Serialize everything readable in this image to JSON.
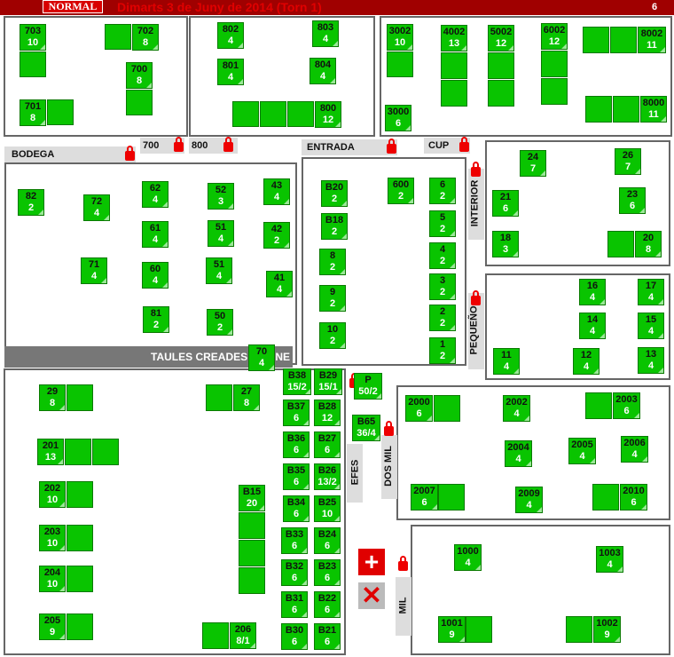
{
  "header": {
    "mode_badge": "NORMAL",
    "title": "Dimarts 3 de Juny de 2014 (Torn 1)",
    "page_number": "6"
  },
  "zone_labels": {
    "bodega": "BODEGA",
    "entrada": "ENTRADA",
    "cup": "CUP",
    "interior": "INTERIOR",
    "pequeno": "PEQUEÑO",
    "taules_creades": "TAULES CREADES",
    "online": "INE",
    "efes": "EFES",
    "dosmil": "DOS MIL",
    "mil": "MIL",
    "gate_700": "700",
    "gate_800": "800"
  },
  "tables": [
    {
      "name": "703",
      "covers": "10"
    },
    {
      "name": "702",
      "covers": "8"
    },
    {
      "name": "700",
      "covers": "8"
    },
    {
      "name": "701",
      "covers": "8"
    },
    {
      "name": "802",
      "covers": "4"
    },
    {
      "name": "803",
      "covers": "4"
    },
    {
      "name": "801",
      "covers": "4"
    },
    {
      "name": "804",
      "covers": "4"
    },
    {
      "name": "800",
      "covers": "12"
    },
    {
      "name": "3002",
      "covers": "10"
    },
    {
      "name": "4002",
      "covers": "13"
    },
    {
      "name": "5002",
      "covers": "12"
    },
    {
      "name": "6002",
      "covers": "12"
    },
    {
      "name": "8002",
      "covers": "11"
    },
    {
      "name": "3000",
      "covers": "6"
    },
    {
      "name": "8000",
      "covers": "11"
    },
    {
      "name": "82",
      "covers": "2"
    },
    {
      "name": "72",
      "covers": "4"
    },
    {
      "name": "62",
      "covers": "4"
    },
    {
      "name": "52",
      "covers": "3"
    },
    {
      "name": "43",
      "covers": "4"
    },
    {
      "name": "61",
      "covers": "4"
    },
    {
      "name": "51",
      "covers": "4"
    },
    {
      "name": "42",
      "covers": "2"
    },
    {
      "name": "71",
      "covers": "4"
    },
    {
      "name": "60",
      "covers": "4"
    },
    {
      "name": "51",
      "covers": "4"
    },
    {
      "name": "41",
      "covers": "4"
    },
    {
      "name": "81",
      "covers": "2"
    },
    {
      "name": "50",
      "covers": "2"
    },
    {
      "name": "70",
      "covers": "4"
    },
    {
      "name": "B20",
      "covers": "2"
    },
    {
      "name": "600",
      "covers": "2"
    },
    {
      "name": "6",
      "covers": "2"
    },
    {
      "name": "B18",
      "covers": "2"
    },
    {
      "name": "5",
      "covers": "2"
    },
    {
      "name": "8",
      "covers": "2"
    },
    {
      "name": "4",
      "covers": "2"
    },
    {
      "name": "9",
      "covers": "2"
    },
    {
      "name": "3",
      "covers": "2"
    },
    {
      "name": "10",
      "covers": "2"
    },
    {
      "name": "2",
      "covers": "2"
    },
    {
      "name": "1",
      "covers": "2"
    },
    {
      "name": "24",
      "covers": "7"
    },
    {
      "name": "26",
      "covers": "7"
    },
    {
      "name": "21",
      "covers": "6"
    },
    {
      "name": "23",
      "covers": "6"
    },
    {
      "name": "18",
      "covers": "3"
    },
    {
      "name": "20",
      "covers": "8"
    },
    {
      "name": "16",
      "covers": "4"
    },
    {
      "name": "17",
      "covers": "4"
    },
    {
      "name": "14",
      "covers": "4"
    },
    {
      "name": "15",
      "covers": "4"
    },
    {
      "name": "11",
      "covers": "4"
    },
    {
      "name": "12",
      "covers": "4"
    },
    {
      "name": "13",
      "covers": "4"
    },
    {
      "name": "29",
      "covers": "8"
    },
    {
      "name": "27",
      "covers": "8"
    },
    {
      "name": "201",
      "covers": "13"
    },
    {
      "name": "202",
      "covers": "10"
    },
    {
      "name": "203",
      "covers": "10"
    },
    {
      "name": "204",
      "covers": "10"
    },
    {
      "name": "205",
      "covers": "9"
    },
    {
      "name": "206",
      "covers": "8/1"
    },
    {
      "name": "B15",
      "covers": "20"
    },
    {
      "name": "B38",
      "covers": "15/2"
    },
    {
      "name": "B29",
      "covers": "15/1"
    },
    {
      "name": "B37",
      "covers": "6"
    },
    {
      "name": "B28",
      "covers": "12"
    },
    {
      "name": "B36",
      "covers": "6"
    },
    {
      "name": "B27",
      "covers": "6"
    },
    {
      "name": "B35",
      "covers": "6"
    },
    {
      "name": "B26",
      "covers": "13/2"
    },
    {
      "name": "B34",
      "covers": "6"
    },
    {
      "name": "B25",
      "covers": "10"
    },
    {
      "name": "B33",
      "covers": "6"
    },
    {
      "name": "B24",
      "covers": "6"
    },
    {
      "name": "B32",
      "covers": "6"
    },
    {
      "name": "B23",
      "covers": "6"
    },
    {
      "name": "B31",
      "covers": "6"
    },
    {
      "name": "B22",
      "covers": "6"
    },
    {
      "name": "B30",
      "covers": "6"
    },
    {
      "name": "B21",
      "covers": "6"
    },
    {
      "name": "P",
      "covers": "50/2"
    },
    {
      "name": "B65",
      "covers": "36/4"
    },
    {
      "name": "2000",
      "covers": "6"
    },
    {
      "name": "2002",
      "covers": "4"
    },
    {
      "name": "2003",
      "covers": "6"
    },
    {
      "name": "2004",
      "covers": "4"
    },
    {
      "name": "2005",
      "covers": "4"
    },
    {
      "name": "2006",
      "covers": "4"
    },
    {
      "name": "2007",
      "covers": "6"
    },
    {
      "name": "2009",
      "covers": "4"
    },
    {
      "name": "2010",
      "covers": "6"
    },
    {
      "name": "1000",
      "covers": "4"
    },
    {
      "name": "1003",
      "covers": "4"
    },
    {
      "name": "1001",
      "covers": "9"
    },
    {
      "name": "1002",
      "covers": "9"
    }
  ],
  "actions": {
    "add_icon": "plus-icon",
    "cancel_icon": "x-icon"
  }
}
